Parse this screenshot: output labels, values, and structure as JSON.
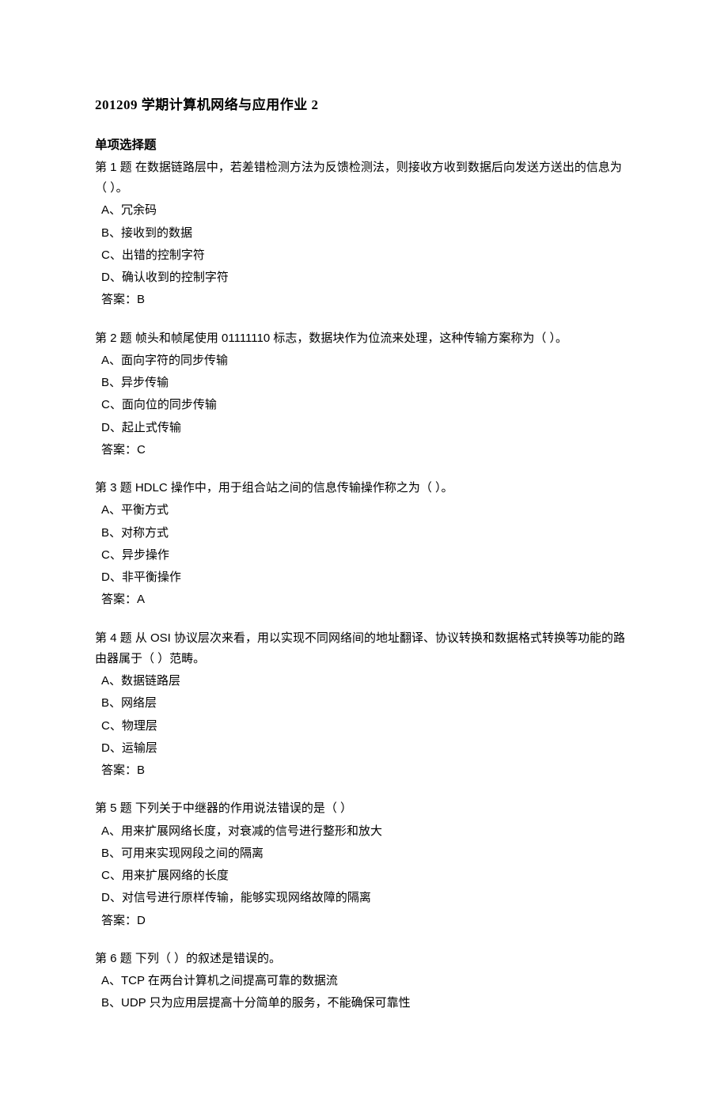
{
  "title": "201209 学期计算机网络与应用作业 2",
  "section_heading": "单项选择题",
  "questions": [
    {
      "text": "第 1 题  在数据链路层中，若差错检测方法为反馈检测法，则接收方收到数据后向发送方送出的信息为（   ）。",
      "options": [
        "A、冗余码",
        "B、接收到的数据",
        "C、出错的控制字符",
        "D、确认收到的控制字符"
      ],
      "answer": "答案：B"
    },
    {
      "text": "第 2 题  帧头和帧尾使用 01111110 标志，数据块作为位流来处理，这种传输方案称为（   ）。",
      "options": [
        "A、面向字符的同步传输",
        "B、异步传输",
        "C、面向位的同步传输",
        "D、起止式传输"
      ],
      "answer": "答案：C"
    },
    {
      "text": "第 3 题  HDLC 操作中，用于组合站之间的信息传输操作称之为（   ）。",
      "options": [
        "A、平衡方式",
        "B、对称方式",
        "C、异步操作",
        "D、非平衡操作"
      ],
      "answer": "答案：A"
    },
    {
      "text": "第 4 题  从 OSI 协议层次来看，用以实现不同网络间的地址翻译、协议转换和数据格式转换等功能的路由器属于（   ）范畴。",
      "options": [
        "A、数据链路层",
        "B、网络层",
        "C、物理层",
        "D、运输层"
      ],
      "answer": "答案：B"
    },
    {
      "text": "第 5 题  下列关于中继器的作用说法错误的是（   ）",
      "options": [
        "A、用来扩展网络长度，对衰减的信号进行整形和放大",
        "B、可用来实现网段之间的隔离",
        "C、用来扩展网络的长度",
        "D、对信号进行原样传输，能够实现网络故障的隔离"
      ],
      "answer": "答案：D"
    },
    {
      "text": "第 6 题  下列（   ）的叙述是错误的。",
      "options": [
        "A、TCP 在两台计算机之间提高可靠的数据流",
        "B、UDP 只为应用层提高十分简单的服务，不能确保可靠性"
      ],
      "answer": ""
    }
  ]
}
